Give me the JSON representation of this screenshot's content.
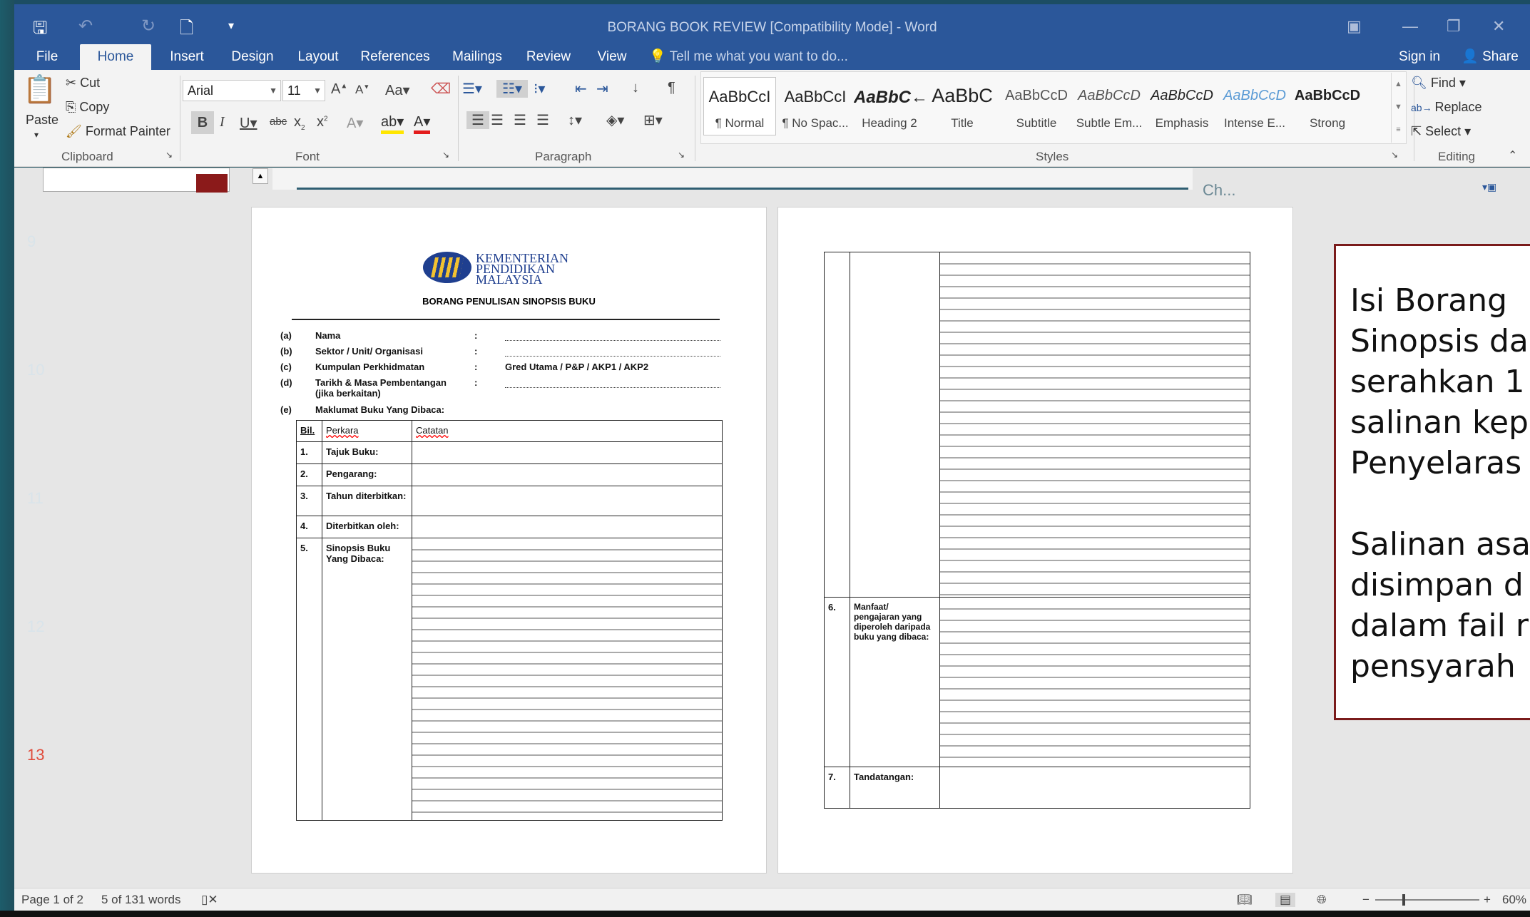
{
  "window": {
    "title": "BORANG BOOK REVIEW [Compatibility Mode] - Word",
    "sign_in": "Sign in",
    "share": "Share"
  },
  "tabs": [
    "File",
    "Home",
    "Insert",
    "Design",
    "Layout",
    "References",
    "Mailings",
    "Review",
    "View"
  ],
  "tell_me": "Tell me what you want to do...",
  "clipboard": {
    "paste": "Paste",
    "cut": "Cut",
    "copy": "Copy",
    "format_painter": "Format Painter",
    "label": "Clipboard"
  },
  "font": {
    "name": "Arial",
    "size": "11",
    "label": "Font"
  },
  "paragraph": {
    "label": "Paragraph"
  },
  "styles": {
    "label": "Styles",
    "items": [
      {
        "sample": "AaBbCcI",
        "name": "¶ Normal"
      },
      {
        "sample": "AaBbCcI",
        "name": "¶ No Spac..."
      },
      {
        "sample": "AaBbC←",
        "name": "Heading 2"
      },
      {
        "sample": "AaBbC",
        "name": "Title"
      },
      {
        "sample": "AaBbCcD",
        "name": "Subtitle"
      },
      {
        "sample": "AaBbCcD",
        "name": "Subtle Em..."
      },
      {
        "sample": "AaBbCcD",
        "name": "Emphasis"
      },
      {
        "sample": "AaBbCcD",
        "name": "Intense E..."
      },
      {
        "sample": "AaBbCcD",
        "name": "Strong"
      }
    ]
  },
  "editing": {
    "find": "Find",
    "replace": "Replace",
    "select": "Select",
    "label": "Editing"
  },
  "slide_numbers": [
    "9",
    "10",
    "11",
    "12",
    "13"
  ],
  "page1": {
    "logo_lines": [
      "KEMENTERIAN",
      "PENDIDIKAN",
      "MALAYSIA"
    ],
    "heading": "BORANG PENULISAN SINOPSIS BUKU",
    "fields": [
      {
        "key": "(a)",
        "label": "Nama",
        "value": ""
      },
      {
        "key": "(b)",
        "label": "Sektor / Unit/ Organisasi",
        "value": ""
      },
      {
        "key": "(c)",
        "label": "Kumpulan Perkhidmatan",
        "value": "Gred Utama / P&P / AKP1 / AKP2"
      },
      {
        "key": "(d)",
        "label": "Tarikh & Masa Pembentangan",
        "label2": "(jika berkaitan)",
        "value": ""
      },
      {
        "key": "(e)",
        "label": "Maklumat Buku Yang Dibaca:",
        "value": ""
      }
    ],
    "table_head": [
      "Bil.",
      "Perkara",
      "Catatan"
    ],
    "rows": [
      {
        "no": "1.",
        "item": "Tajuk Buku:"
      },
      {
        "no": "2.",
        "item": "Pengarang:"
      },
      {
        "no": "3.",
        "item": "Tahun diterbitkan:"
      },
      {
        "no": "4.",
        "item": "Diterbitkan oleh:"
      },
      {
        "no": "5.",
        "item": "Sinopsis Buku Yang Dibaca:"
      }
    ]
  },
  "page2": {
    "rows": [
      {
        "no": "6.",
        "item": "Manfaat/ pengajaran yang diperoleh daripada buku yang dibaca:"
      },
      {
        "no": "7.",
        "item": "Tandatangan:"
      }
    ]
  },
  "callout": {
    "lines": [
      "Isi Borang",
      "Sinopsis da",
      "serahkan 1",
      "salinan kep",
      "Penyelaras",
      "",
      "Salinan asa",
      "disimpan d",
      "dalam fail r",
      "pensyarah"
    ]
  },
  "status": {
    "page": "Page 1 of 2",
    "words": "5 of 131 words",
    "zoom": "60%"
  },
  "colors": {
    "word_blue": "#2b579a",
    "callout_border": "#7a1b1b"
  }
}
